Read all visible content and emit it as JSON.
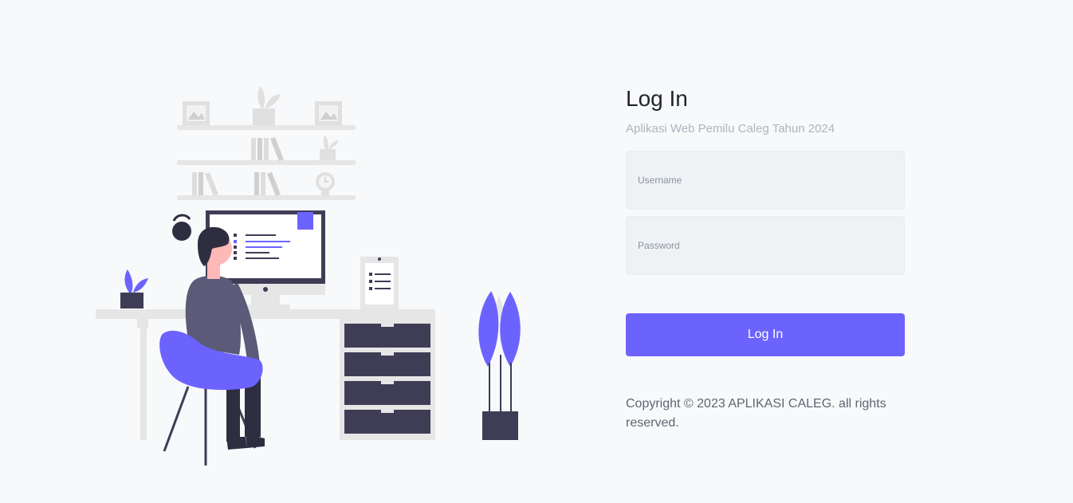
{
  "login": {
    "title": "Log In",
    "subtitle": "Aplikasi Web Pemilu Caleg Tahun 2024",
    "username_placeholder": "Username",
    "password_placeholder": "Password",
    "button_label": "Log In",
    "copyright": "Copyright © 2023 APLIKASI CALEG. all rights reserved."
  },
  "colors": {
    "accent": "#6c63ff",
    "background": "#f8f9fb",
    "field_background": "#eef2f5",
    "dark": "#3f3d56"
  },
  "illustration": {
    "name": "woman-at-desk-illustration"
  }
}
